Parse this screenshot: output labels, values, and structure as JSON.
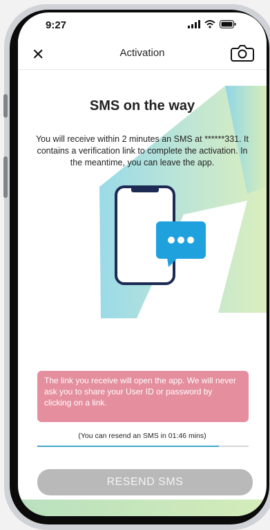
{
  "status_bar": {
    "time": "9:27"
  },
  "nav": {
    "title": "Activation"
  },
  "main": {
    "heading": "SMS on the way",
    "description": "You will receive within 2 minutes an SMS at ******331. It contains a verification link to complete the activation. In the meantime, you can leave the app.",
    "alert": "The link you receive will open the app. We will never ask you to share your User ID or password by clicking on a link.",
    "resend_note": "(You can resend an SMS in 01:46 mins)",
    "countdown_progress": 0.86,
    "resend_button": "RESEND SMS"
  },
  "colors": {
    "alert_bg": "#e48e9e",
    "progress_accent": "#3fa6c8",
    "button_disabled": "#b9b9b9",
    "phone_illustration": "#1c2a54",
    "chat_bubble": "#1fa1de"
  },
  "icons": [
    "close-icon",
    "camera-icon",
    "signal-icon",
    "wifi-icon",
    "battery-icon",
    "phone-icon",
    "chat-bubble-icon"
  ]
}
